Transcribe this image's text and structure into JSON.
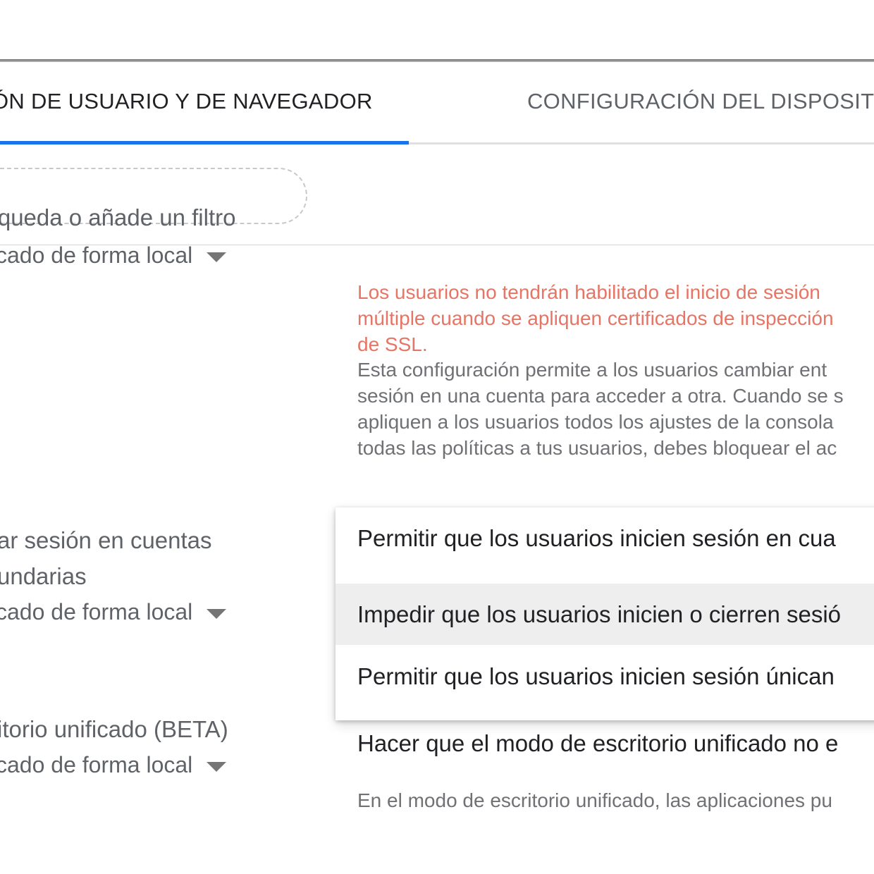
{
  "tabs": {
    "active_label": "ÓN DE USUARIO Y DE NAVEGADOR",
    "inactive_label": "CONFIGURACIÓN DEL DISPOSITIV"
  },
  "search": {
    "placeholder": "úsqueda o añade un filtro"
  },
  "settings": [
    {
      "inherit_label": "cado de forma local",
      "warning": "Los usuarios no tendrán habilitado el inicio de sesión múltiple cuando se apliquen certificados de inspección de SSL.",
      "description_lines": [
        "Esta configuración permite a los usuarios cambiar ent",
        "sesión en una cuenta para acceder a otra. Cuando se s",
        "apliquen a los usuarios todos los ajustes de la consola",
        "todas las políticas a tus usuarios, debes bloquear el ac"
      ]
    },
    {
      "title_line1": "ar sesión en cuentas",
      "title_line2": "undarias",
      "inherit_label": "cado de forma local",
      "dropdown_options": [
        "Permitir que los usuarios inicien sesión en cua",
        "Impedir que los usuarios inicien o cierren sesió",
        "Permitir que los usuarios inicien sesión únican"
      ],
      "selected_option_index": 1
    },
    {
      "title": "itorio unificado (BETA)",
      "inherit_label": "cado de forma local",
      "value": "Hacer que el modo de escritorio unificado no e",
      "description": "En el modo de escritorio unificado, las aplicaciones pu"
    }
  ],
  "colors": {
    "accent": "#1a73e8",
    "warning": "#e57565",
    "selected_row": "#eeeeee"
  }
}
